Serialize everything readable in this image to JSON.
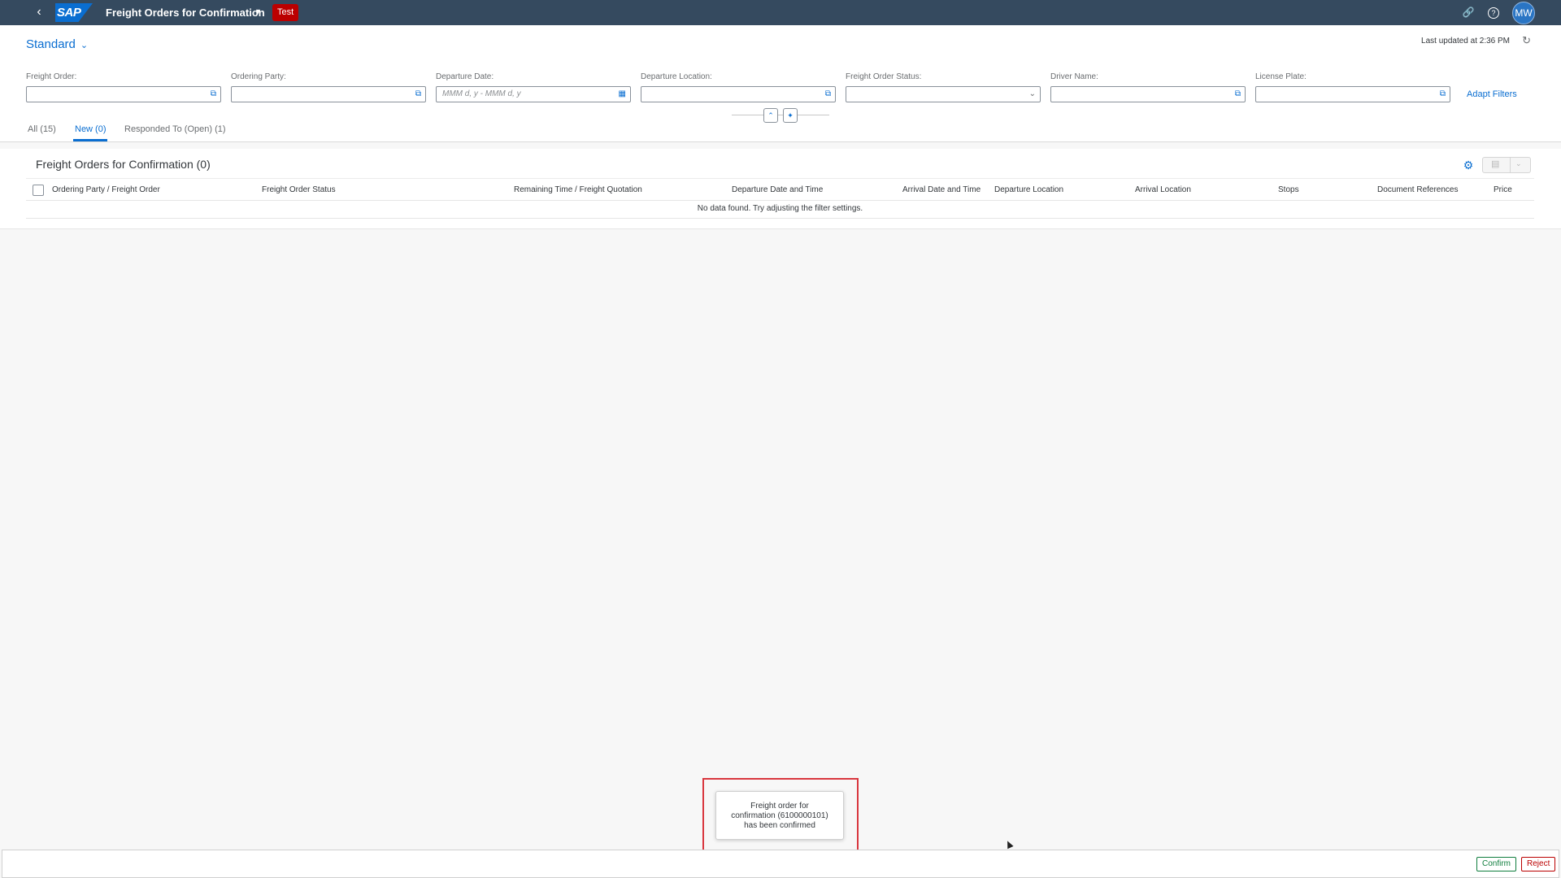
{
  "shell": {
    "back_icon": "back-arrow-icon",
    "logo_text": "SAP",
    "app_title": "Freight Orders for Confirmation",
    "env_badge": "Test",
    "avatar_initials": "MW",
    "icons": [
      "link-icon",
      "help-icon"
    ],
    "colors": {
      "bar": "#354a5f",
      "brand": "#0a6ed1",
      "badge": "#bb0000"
    }
  },
  "header": {
    "variant_label": "Standard",
    "last_updated": "Last updated at 2:36 PM",
    "adapt_filters": "Adapt Filters",
    "filters": [
      {
        "label": "Freight Order:",
        "placeholder": ""
      },
      {
        "label": "Ordering Party:",
        "placeholder": ""
      },
      {
        "label": "Departure Date:",
        "placeholder": "MMM d, y - MMM d, y"
      },
      {
        "label": "Departure Location:",
        "placeholder": ""
      },
      {
        "label": "Freight Order Status:",
        "placeholder": ""
      },
      {
        "label": "Driver Name:",
        "placeholder": ""
      },
      {
        "label": "License Plate:",
        "placeholder": ""
      }
    ],
    "tabs": [
      {
        "label": "All (15)",
        "selected": false
      },
      {
        "label": "New (0)",
        "selected": true
      },
      {
        "label": "Responded To (Open) (1)",
        "selected": false
      }
    ]
  },
  "table": {
    "title": "Freight Orders for Confirmation (0)",
    "columns": [
      "Ordering Party / Freight Order",
      "Freight Order Status",
      "Remaining Time / Freight Quotation",
      "Departure Date and Time",
      "Arrival Date and Time",
      "Departure Location",
      "Arrival Location",
      "Stops",
      "Document References",
      "Price"
    ],
    "no_data": "No data found. Try adjusting the filter settings."
  },
  "toast": {
    "line1": "Freight order for",
    "line2": "confirmation (6100000101)",
    "line3": "has been confirmed"
  },
  "footer": {
    "confirm_label": "Confirm",
    "reject_label": "Reject"
  }
}
